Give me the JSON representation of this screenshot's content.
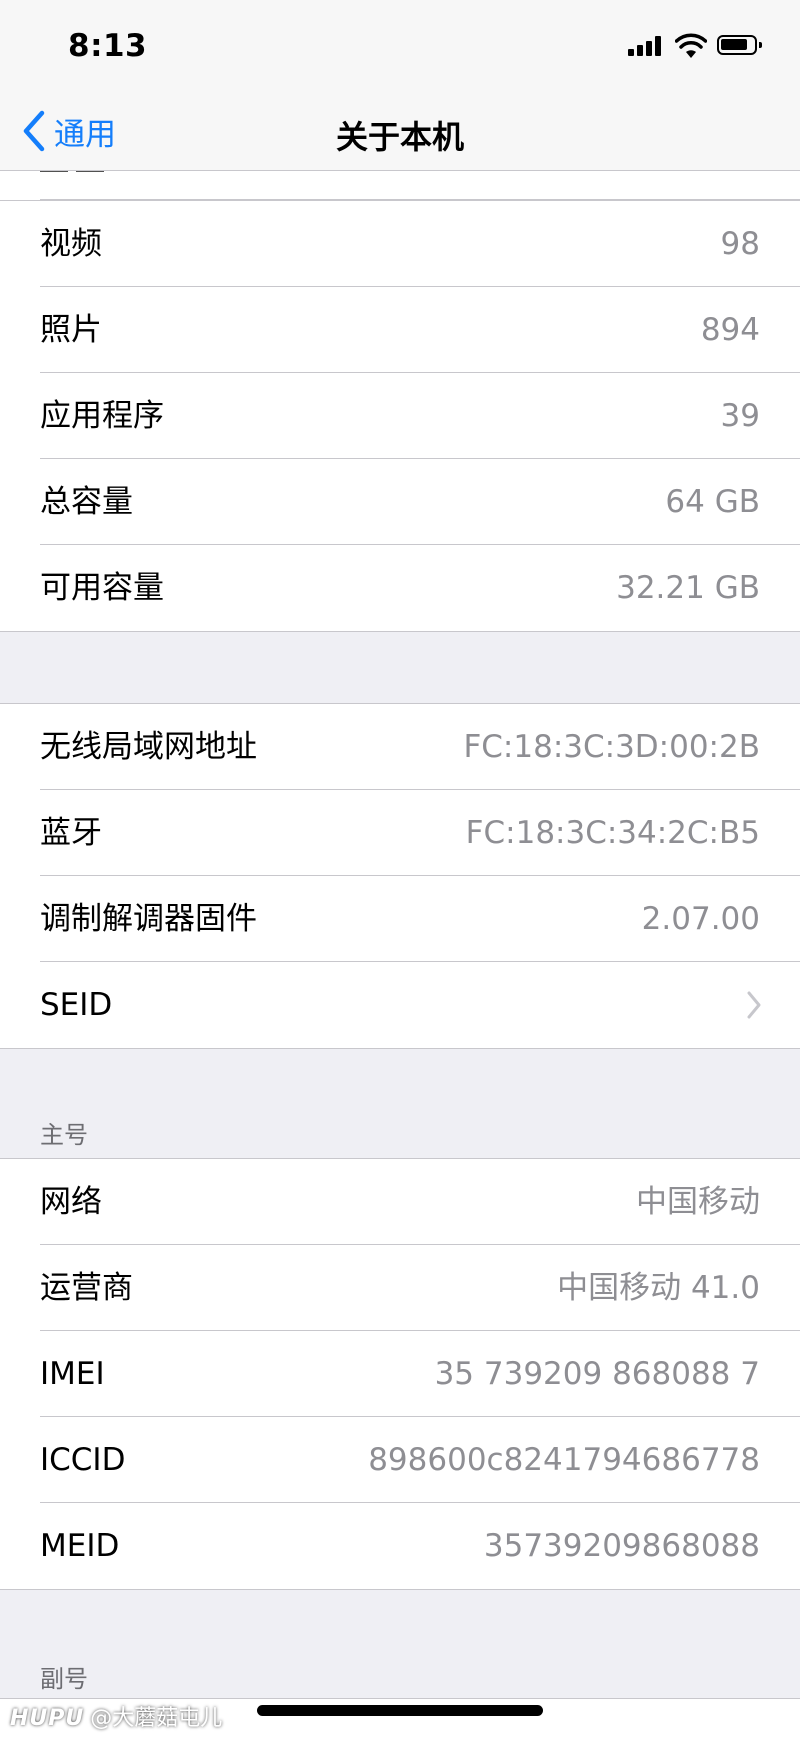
{
  "status_bar": {
    "time": "8:13"
  },
  "nav": {
    "back_label": "通用",
    "title": "关于本机"
  },
  "group1": [
    {
      "label": "视频",
      "value": "98"
    },
    {
      "label": "照片",
      "value": "894"
    },
    {
      "label": "应用程序",
      "value": "39"
    },
    {
      "label": "总容量",
      "value": "64 GB"
    },
    {
      "label": "可用容量",
      "value": "32.21 GB"
    }
  ],
  "group2": [
    {
      "label": "无线局域网地址",
      "value": "FC:18:3C:3D:00:2B"
    },
    {
      "label": "蓝牙",
      "value": "FC:18:3C:34:2C:B5"
    },
    {
      "label": "调制解调器固件",
      "value": "2.07.00"
    },
    {
      "label": "SEID"
    }
  ],
  "primary": {
    "header": "主号",
    "rows": [
      {
        "label": "网络",
        "value": "中国移动"
      },
      {
        "label": "运营商",
        "value": "中国移动 41.0"
      },
      {
        "label": "IMEI",
        "value": "35 739209 868088 7"
      },
      {
        "label": "ICCID",
        "value": "898600c8241794686778"
      },
      {
        "label": "MEID",
        "value": "35739209868088"
      }
    ]
  },
  "secondary": {
    "header": "副号"
  },
  "watermark": {
    "brand": "HUPU",
    "text": "@大蘑菇屯儿"
  },
  "colors": {
    "accent": "#147efb",
    "secondary_text": "#8e8e93",
    "background": "#efeff4",
    "separator": "#c8c7cc"
  }
}
